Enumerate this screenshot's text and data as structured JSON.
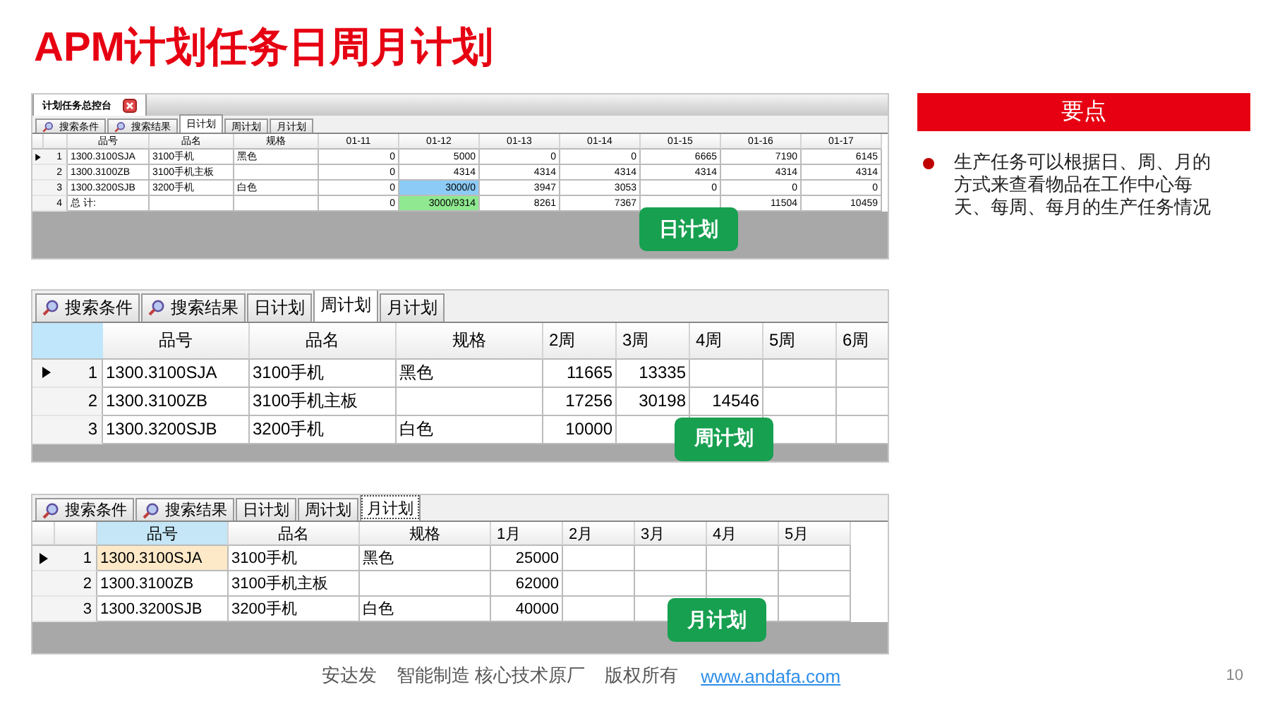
{
  "title": "APM计划任务日周月计划",
  "panels": [
    {
      "window_tab": "计划任务总控台",
      "tabs": [
        {
          "label": "搜索条件",
          "kind": "search",
          "selected": false
        },
        {
          "label": "搜索结果",
          "kind": "search",
          "selected": false
        },
        {
          "label": "日计划",
          "kind": "plain",
          "selected": true
        },
        {
          "label": "周计划",
          "kind": "plain",
          "selected": false
        },
        {
          "label": "月计划",
          "kind": "plain",
          "selected": false
        }
      ],
      "columns": [
        "品号",
        "品名",
        "规格",
        "01-11",
        "01-12",
        "01-13",
        "01-14",
        "01-15",
        "01-16",
        "01-17"
      ],
      "rows": [
        {
          "number": "1",
          "current": true,
          "cells": [
            "1300.3100SJA",
            "3100手机",
            "黑色",
            "0",
            "5000",
            "0",
            "0",
            "6665",
            "7190",
            "6145"
          ]
        },
        {
          "number": "2",
          "current": false,
          "cells": [
            "1300.3100ZB",
            "3100手机主板",
            null,
            "0",
            "4314",
            "4314",
            "4314",
            "4314",
            "4314",
            "4314"
          ]
        },
        {
          "number": "3",
          "current": false,
          "cells": [
            "1300.3200SJB",
            "3200手机",
            "白色",
            "0",
            {
              "text": "3000/0",
              "color": "#8ccbf5"
            },
            "3947",
            "3053",
            "0",
            "0",
            "0"
          ]
        },
        {
          "number": "4",
          "current": false,
          "cells": [
            "总  计:",
            null,
            null,
            "0",
            {
              "text": "3000/9314",
              "color": "#90e890"
            },
            "8261",
            "7367",
            null,
            "11504",
            "10459"
          ]
        }
      ],
      "badge": "日计划"
    },
    {
      "tabs": [
        {
          "label": "搜索条件",
          "kind": "search",
          "selected": false
        },
        {
          "label": "搜索结果",
          "kind": "search",
          "selected": false
        },
        {
          "label": "日计划",
          "kind": "plain",
          "selected": false
        },
        {
          "label": "周计划",
          "kind": "plain",
          "selected": true
        },
        {
          "label": "月计划",
          "kind": "plain",
          "selected": false
        }
      ],
      "columns": [
        "品号",
        "品名",
        "规格",
        "2周",
        "3周",
        "4周",
        "5周",
        "6周"
      ],
      "rows": [
        {
          "number": "1",
          "current": true,
          "cells": [
            "1300.3100SJA",
            "3100手机",
            "黑色",
            "11665",
            "13335",
            null,
            null,
            null
          ]
        },
        {
          "number": "2",
          "current": false,
          "cells": [
            "1300.3100ZB",
            "3100手机主板",
            null,
            "17256",
            "30198",
            "14546",
            null,
            null
          ]
        },
        {
          "number": "3",
          "current": false,
          "cells": [
            "1300.3200SJB",
            "3200手机",
            "白色",
            "10000",
            null,
            null,
            null,
            null
          ]
        }
      ],
      "badge": "周计划"
    },
    {
      "tabs": [
        {
          "label": "搜索条件",
          "kind": "search",
          "selected": false
        },
        {
          "label": "搜索结果",
          "kind": "search",
          "selected": false
        },
        {
          "label": "日计划",
          "kind": "plain",
          "selected": false
        },
        {
          "label": "周计划",
          "kind": "plain",
          "selected": false
        },
        {
          "label": "月计划",
          "kind": "plain",
          "selected": true
        }
      ],
      "columns": [
        {
          "text": "品号",
          "color": "#c4e6f6"
        },
        "品名",
        "规格",
        "1月",
        "2月",
        "3月",
        "4月",
        "5月"
      ],
      "rows": [
        {
          "number": "1",
          "current": true,
          "cells": [
            {
              "text": "1300.3100SJA",
              "color": "#fde9c8"
            },
            "3100手机",
            "黑色",
            "25000",
            null,
            null,
            null,
            null
          ]
        },
        {
          "number": "2",
          "current": false,
          "cells": [
            "1300.3100ZB",
            "3100手机主板",
            null,
            "62000",
            null,
            null,
            null,
            null
          ]
        },
        {
          "number": "3",
          "current": false,
          "cells": [
            "1300.3200SJB",
            "3200手机",
            "白色",
            "40000",
            null,
            null,
            null,
            null
          ]
        }
      ],
      "badge": "月计划"
    }
  ],
  "key_points": {
    "heading": "要点",
    "items": [
      "生产任务可以根据日、周、月的方式来查看物品在工作中心每天、每周、每月的生产任务情况"
    ]
  },
  "footer": {
    "texts": [
      "安达发",
      "智能制造 核心技术原厂",
      "版权所有"
    ],
    "link": "www.andafa.com",
    "page_number": "10"
  }
}
